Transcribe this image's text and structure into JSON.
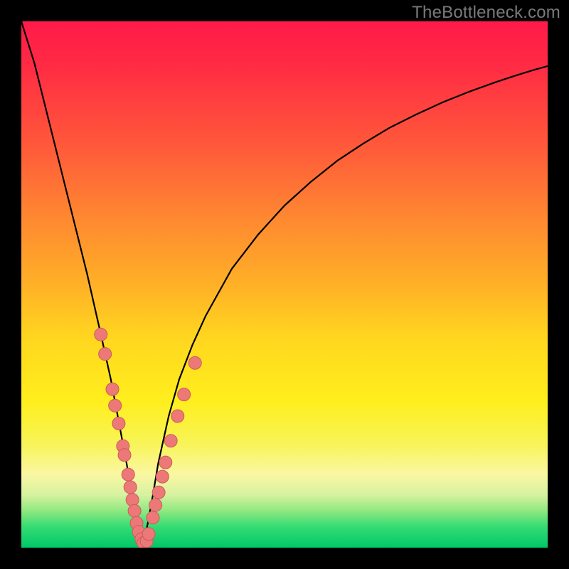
{
  "watermark": "TheBottleneck.com",
  "colors": {
    "frame": "#000000",
    "curve": "#000000",
    "marker_fill": "#ed7878",
    "marker_stroke": "#cc5a5a"
  },
  "chart_data": {
    "type": "line",
    "title": "",
    "xlabel": "",
    "ylabel": "",
    "xlim": [
      0,
      100
    ],
    "ylim": [
      0,
      100
    ],
    "grid": false,
    "note": "No axes, ticks, or numeric labels are rendered. Curve represents a bottleneck/mismatch metric with a deep V whose minimum (~0) occurs near x≈23. Values are estimated from pixel positions in the original image; precision is limited by absence of axis labels.",
    "series": [
      {
        "name": "bottleneck-curve",
        "x": [
          0,
          2.5,
          5,
          7.5,
          10,
          12.5,
          15,
          17,
          18.5,
          20,
          21,
          22,
          22.5,
          23,
          23.5,
          24,
          25,
          26,
          28,
          30,
          32.5,
          35,
          40,
          45,
          50,
          55,
          60,
          65,
          70,
          75,
          80,
          85,
          90,
          93,
          95.5,
          97.5,
          100
        ],
        "y": [
          100,
          92,
          82,
          72,
          62,
          52,
          41,
          32,
          24,
          16,
          10,
          4.5,
          2,
          0.5,
          2,
          4.5,
          10,
          16,
          25,
          32,
          38.5,
          44,
          53,
          59.5,
          65,
          69.5,
          73.5,
          76.8,
          79.8,
          82.3,
          84.6,
          86.6,
          88.4,
          89.4,
          90.2,
          90.8,
          91.5
        ]
      }
    ],
    "markers": [
      {
        "x": 15.1,
        "y": 40.5,
        "r": 9
      },
      {
        "x": 15.9,
        "y": 36.8,
        "r": 9
      },
      {
        "x": 17.3,
        "y": 30.1,
        "r": 9
      },
      {
        "x": 17.8,
        "y": 27.0,
        "r": 9
      },
      {
        "x": 18.5,
        "y": 23.6,
        "r": 9
      },
      {
        "x": 19.3,
        "y": 19.3,
        "r": 9
      },
      {
        "x": 19.6,
        "y": 17.6,
        "r": 9
      },
      {
        "x": 20.3,
        "y": 13.9,
        "r": 9
      },
      {
        "x": 20.7,
        "y": 11.5,
        "r": 9
      },
      {
        "x": 21.1,
        "y": 9.1,
        "r": 9
      },
      {
        "x": 21.5,
        "y": 7.0,
        "r": 9
      },
      {
        "x": 21.9,
        "y": 4.7,
        "r": 9
      },
      {
        "x": 22.3,
        "y": 3.0,
        "r": 9
      },
      {
        "x": 22.8,
        "y": 1.6,
        "r": 9
      },
      {
        "x": 23.2,
        "y": 0.9,
        "r": 9
      },
      {
        "x": 23.8,
        "y": 1.2,
        "r": 9
      },
      {
        "x": 24.2,
        "y": 2.6,
        "r": 9
      },
      {
        "x": 25.0,
        "y": 5.7,
        "r": 9
      },
      {
        "x": 25.5,
        "y": 8.1,
        "r": 9
      },
      {
        "x": 26.1,
        "y": 10.5,
        "r": 9
      },
      {
        "x": 26.8,
        "y": 13.5,
        "r": 9
      },
      {
        "x": 27.4,
        "y": 16.2,
        "r": 9
      },
      {
        "x": 28.4,
        "y": 20.3,
        "r": 9
      },
      {
        "x": 29.7,
        "y": 25.0,
        "r": 9
      },
      {
        "x": 30.9,
        "y": 29.1,
        "r": 9
      },
      {
        "x": 33.0,
        "y": 35.1,
        "r": 9
      }
    ]
  }
}
